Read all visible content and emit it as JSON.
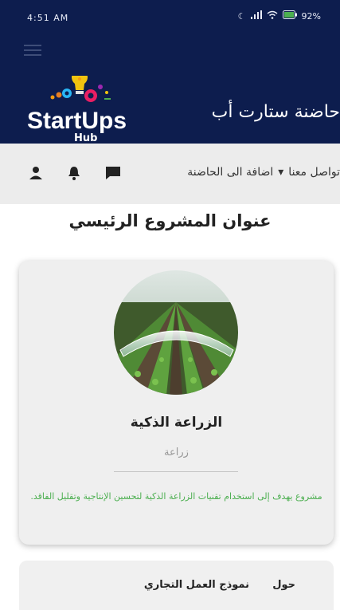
{
  "status_bar": {
    "time": "4:51 AM",
    "battery": "92%"
  },
  "header": {
    "logo_main": "StartUps",
    "logo_sub": "Hub",
    "site_title": "حاضنة ستارت أب"
  },
  "nav": {
    "contact": "تواصل معنا",
    "add_to_incubator": "اضافة الى الحاضنة"
  },
  "page": {
    "main_title": "عنوان المشروع الرئيسي"
  },
  "project": {
    "name": "الزراعة الذكية",
    "category": "زراعة",
    "description": "مشروع يهدف إلى استخدام تقنيات الزراعة الذكية لتحسين الإنتاجية وتقليل الفاقد."
  },
  "tabs": [
    {
      "label": "حول"
    },
    {
      "label": "نموذج العمل التجاري"
    }
  ],
  "colors": {
    "header_bg": "#0d1d4e",
    "accent_green": "#4caf50",
    "navbar_bg": "#ececec"
  }
}
